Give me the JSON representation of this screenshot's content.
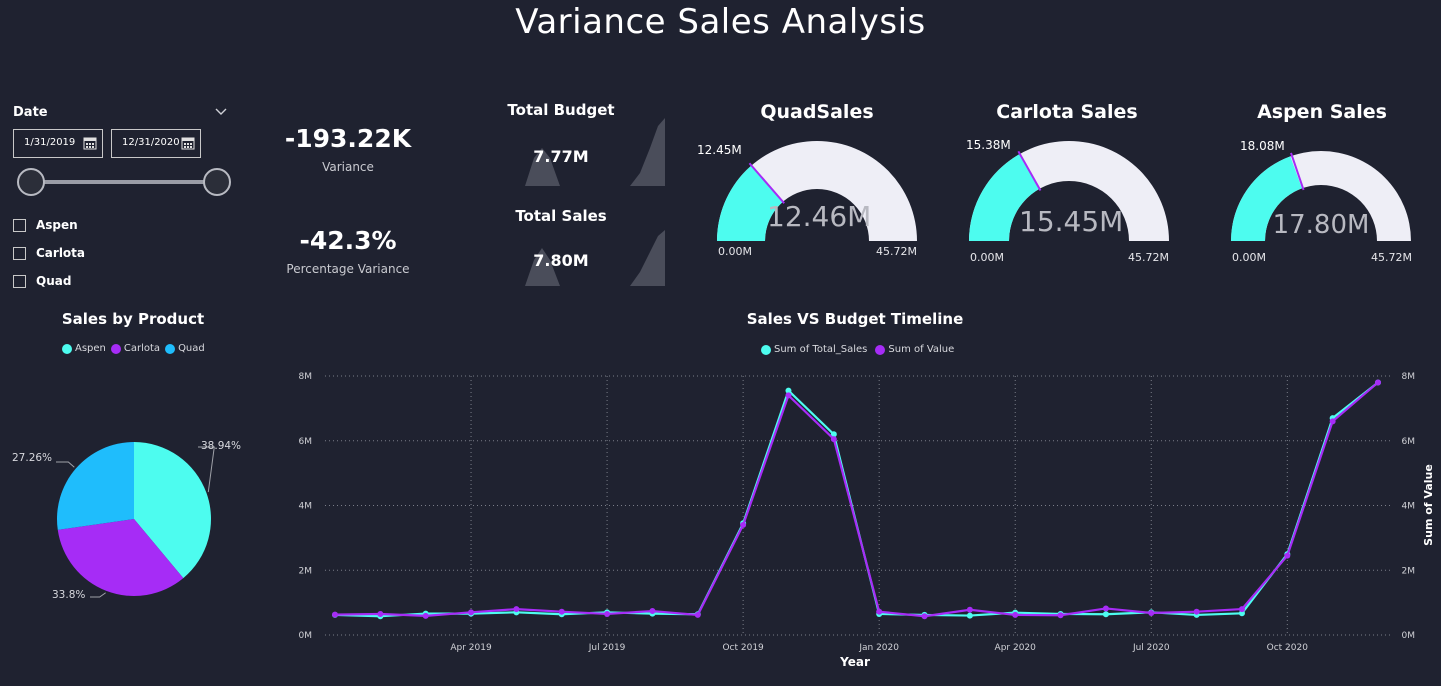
{
  "title": "Variance Sales  Analysis",
  "slicer": {
    "label": "Date",
    "start_date": "1/31/2019",
    "end_date": "12/31/2020",
    "options": [
      "Aspen",
      "Carlota",
      "Quad"
    ]
  },
  "kpis": {
    "variance_value": "-193.22K",
    "variance_label": "Variance",
    "pct_value": "-42.3%",
    "pct_label": "Percentage Variance",
    "budget_title": "Total Budget",
    "budget_value": "7.77M",
    "sales_title": "Total Sales",
    "sales_value": "7.80M"
  },
  "gauges": [
    {
      "title": "QuadSales",
      "value_label": "12.46M",
      "target_label": "12.45M",
      "min_label": "0.00M",
      "max_label": "45.72M",
      "value": 12.46,
      "target": 12.45,
      "max": 45.72
    },
    {
      "title": "Carlota Sales",
      "value_label": "15.45M",
      "target_label": "15.38M",
      "min_label": "0.00M",
      "max_label": "45.72M",
      "value": 15.45,
      "target": 15.38,
      "max": 45.72
    },
    {
      "title": "Aspen Sales",
      "value_label": "17.80M",
      "target_label": "18.08M",
      "min_label": "0.00M",
      "max_label": "45.72M",
      "value": 17.8,
      "target": 18.08,
      "max": 45.72
    }
  ],
  "colors": {
    "background": "#1f2230",
    "aspen": "#4dfcef",
    "carlota": "#a62cf6",
    "quad": "#1fbdfc",
    "gauge_track": "#eeeef6",
    "sales_line": "#4dfcef",
    "budget_line": "#a62cf6"
  },
  "chart_data": [
    {
      "type": "pie",
      "title": "Sales by Product",
      "legend": [
        "Aspen",
        "Carlota",
        "Quad"
      ],
      "slices": [
        {
          "name": "Aspen",
          "value": 38.94,
          "label": "38.94%"
        },
        {
          "name": "Carlota",
          "value": 33.8,
          "label": "33.8%"
        },
        {
          "name": "Quad",
          "value": 27.26,
          "label": "27.26%"
        }
      ]
    },
    {
      "type": "line",
      "title": "Sales VS Budget Timeline",
      "xlabel": "Year",
      "ylabel_right": "Sum of Value",
      "legend": [
        "Sum of Total_Sales",
        "Sum of Value"
      ],
      "grid": true,
      "ylim": [
        0,
        8000000
      ],
      "y_ticks": [
        "0M",
        "2M",
        "4M",
        "6M",
        "8M"
      ],
      "x_ticks": [
        "Apr 2019",
        "Jul 2019",
        "Oct 2019",
        "Jan 2020",
        "Apr 2020",
        "Jul 2020",
        "Oct 2020"
      ],
      "x": [
        "Jan 2019",
        "Feb 2019",
        "Mar 2019",
        "Apr 2019",
        "May 2019",
        "Jun 2019",
        "Jul 2019",
        "Aug 2019",
        "Sep 2019",
        "Oct 2019",
        "Nov 2019",
        "Dec 2019",
        "Jan 2020",
        "Feb 2020",
        "Mar 2020",
        "Apr 2020",
        "May 2020",
        "Jun 2020",
        "Jul 2020",
        "Aug 2020",
        "Sep 2020",
        "Oct 2020",
        "Nov 2020",
        "Dec 2020"
      ],
      "series": [
        {
          "name": "Sum of Total_Sales",
          "values": [
            620000,
            580000,
            660000,
            660000,
            700000,
            640000,
            700000,
            660000,
            640000,
            3450000,
            7550000,
            6200000,
            650000,
            620000,
            600000,
            690000,
            650000,
            640000,
            700000,
            620000,
            670000,
            2500000,
            6700000,
            7800000
          ]
        },
        {
          "name": "Sum of Value",
          "values": [
            630000,
            650000,
            590000,
            700000,
            800000,
            720000,
            650000,
            740000,
            620000,
            3400000,
            7400000,
            6050000,
            720000,
            580000,
            780000,
            620000,
            610000,
            820000,
            680000,
            720000,
            800000,
            2450000,
            6600000,
            7800000
          ]
        }
      ]
    }
  ]
}
